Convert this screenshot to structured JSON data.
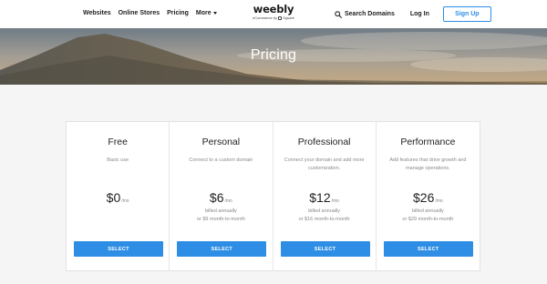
{
  "header": {
    "nav_left": [
      "Websites",
      "Online Stores",
      "Pricing"
    ],
    "more_label": "More",
    "logo_word": "weebly",
    "logo_sub_prefix": "eCommerce by",
    "logo_sub_brand": "Square",
    "search_label": "Search Domains",
    "login_label": "Log In",
    "signup_label": "Sign Up"
  },
  "hero": {
    "title": "Pricing"
  },
  "plans": [
    {
      "name": "Free",
      "description": "Basic use",
      "price": "$0",
      "unit": "/mo",
      "billing_line1": "",
      "billing_line2": "",
      "button": "SELECT"
    },
    {
      "name": "Personal",
      "description": "Connect to a custom domain",
      "price": "$6",
      "unit": "/mo",
      "billing_line1": "billed annually",
      "billing_line2": "or $9 month-to-month",
      "button": "SELECT"
    },
    {
      "name": "Professional",
      "description": "Connect your domain and add more customization.",
      "price": "$12",
      "unit": "/mo",
      "billing_line1": "billed annually",
      "billing_line2": "or $16 month-to-month",
      "button": "SELECT"
    },
    {
      "name": "Performance",
      "description": "Add features that drive growth and manage operations.",
      "price": "$26",
      "unit": "/mo",
      "billing_line1": "billed annually",
      "billing_line2": "or $29 month-to-month",
      "button": "SELECT"
    }
  ],
  "colors": {
    "accent": "#2e8ee5",
    "page_bg": "#f5f5f5",
    "card_bg": "#ffffff"
  }
}
